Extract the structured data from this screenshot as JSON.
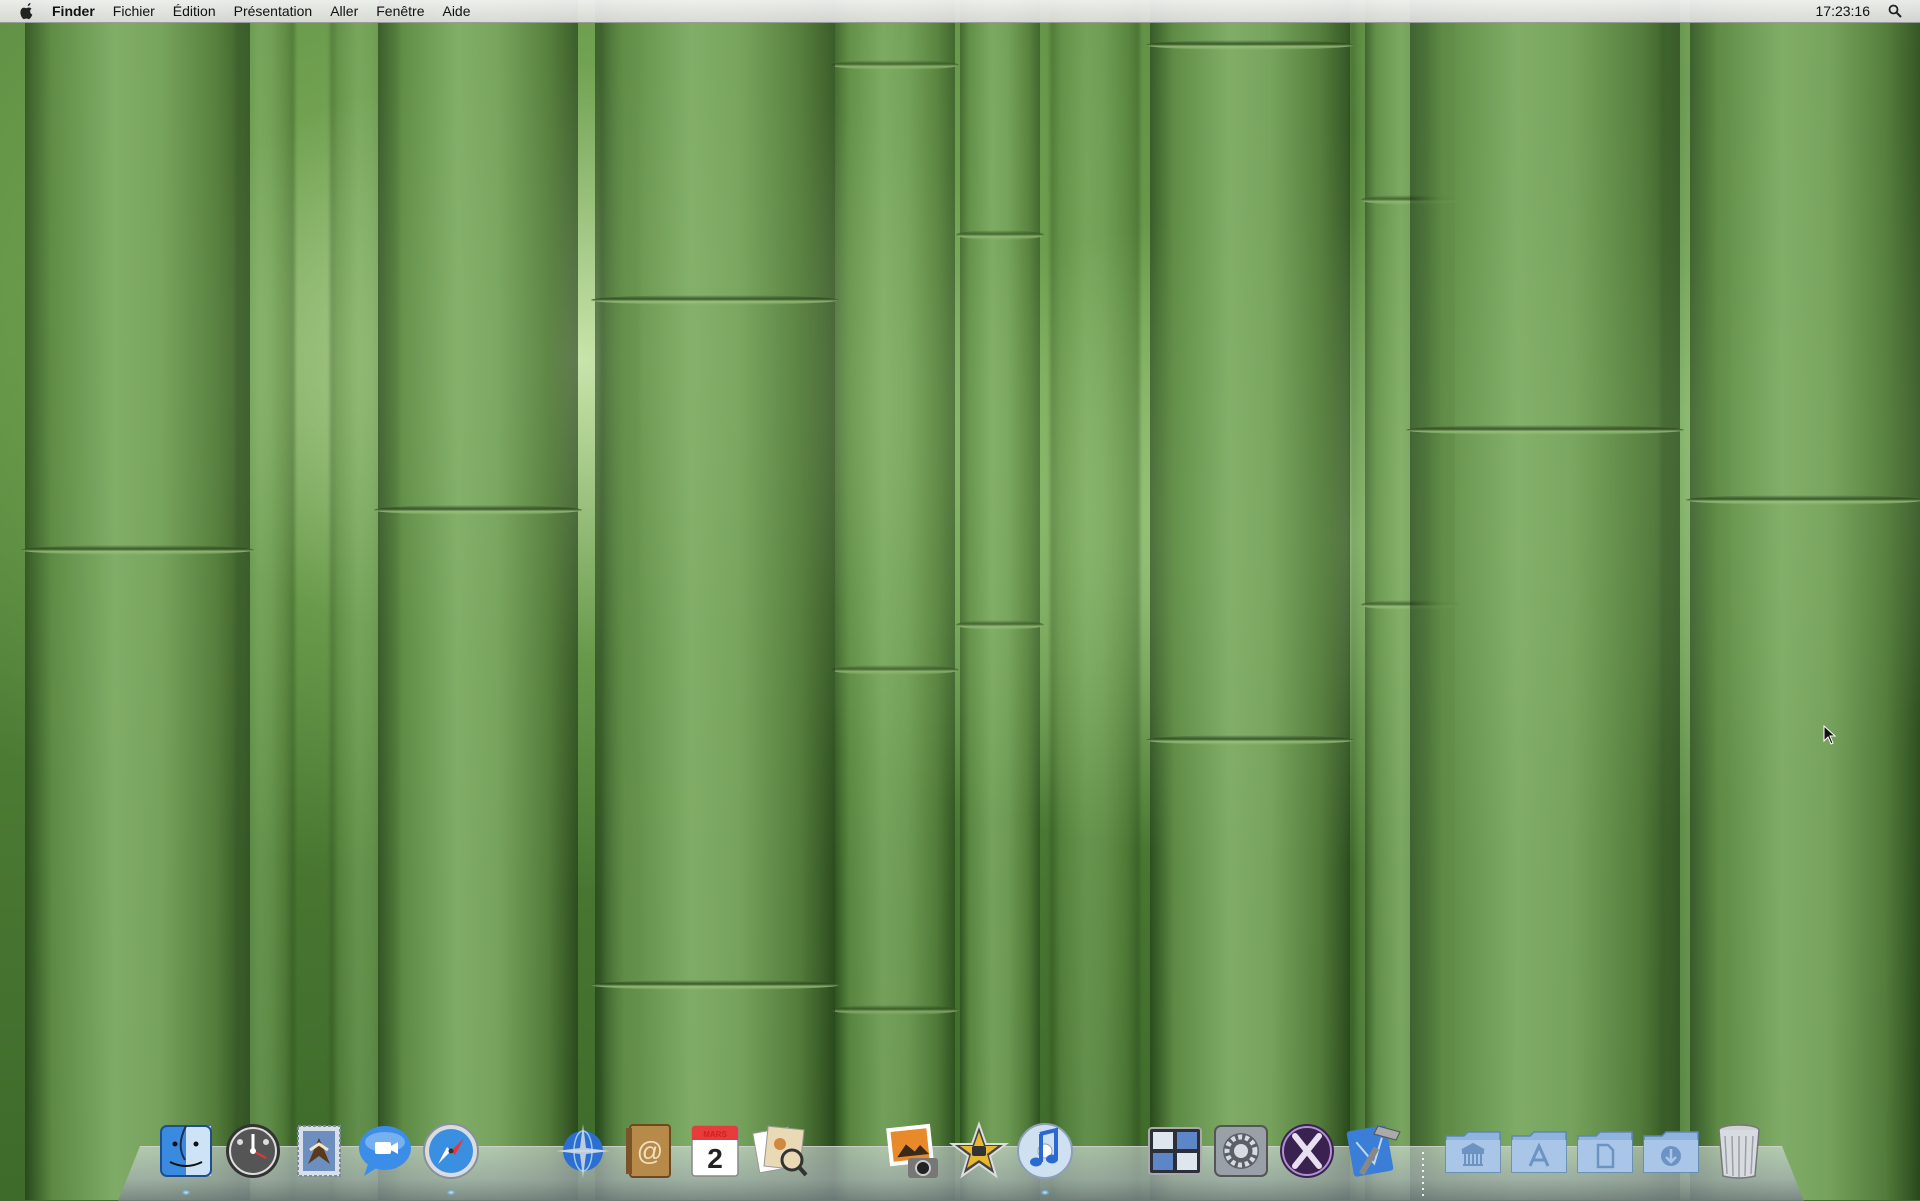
{
  "menubar": {
    "apple_icon": "apple-icon",
    "app_name": "Finder",
    "menus": [
      "Fichier",
      "Édition",
      "Présentation",
      "Aller",
      "Fenêtre",
      "Aide"
    ],
    "clock": "17:23:16",
    "spotlight_icon": "magnifier-icon"
  },
  "dock": {
    "calendar": {
      "month": "MARS",
      "day": "2"
    },
    "apps": [
      {
        "name": "Finder",
        "icon": "finder-icon",
        "running": true
      },
      {
        "name": "Dashboard",
        "icon": "dashboard-icon",
        "running": false
      },
      {
        "name": "Mail",
        "icon": "mail-icon",
        "running": false
      },
      {
        "name": "iChat",
        "icon": "ichat-icon",
        "running": false
      },
      {
        "name": "Safari",
        "icon": "safari-icon",
        "running": true
      },
      {
        "name": "Network",
        "icon": "network-globe-icon",
        "running": false
      },
      {
        "name": "Carnet d'adresses",
        "icon": "address-book-icon",
        "running": false
      },
      {
        "name": "iCal",
        "icon": "ical-icon",
        "running": false
      },
      {
        "name": "Aperçu",
        "icon": "preview-icon",
        "running": false
      },
      {
        "name": "iPhoto",
        "icon": "iphoto-icon",
        "running": false
      },
      {
        "name": "iMovie",
        "icon": "imovie-icon",
        "running": false
      },
      {
        "name": "iTunes",
        "icon": "itunes-icon",
        "running": true
      },
      {
        "name": "Spaces",
        "icon": "spaces-icon",
        "running": false
      },
      {
        "name": "Préférences Système",
        "icon": "system-preferences-icon",
        "running": false
      },
      {
        "name": "Mac OS X",
        "icon": "mac-os-x-icon",
        "running": false
      },
      {
        "name": "Xcode",
        "icon": "xcode-icon",
        "running": false
      }
    ],
    "folders": [
      {
        "name": "Bibliothèque",
        "icon": "library-folder-icon"
      },
      {
        "name": "Applications",
        "icon": "applications-folder-icon"
      },
      {
        "name": "Documents",
        "icon": "documents-folder-icon"
      },
      {
        "name": "Téléchargements",
        "icon": "downloads-folder-icon"
      }
    ],
    "trash_icon": "trash-icon"
  }
}
